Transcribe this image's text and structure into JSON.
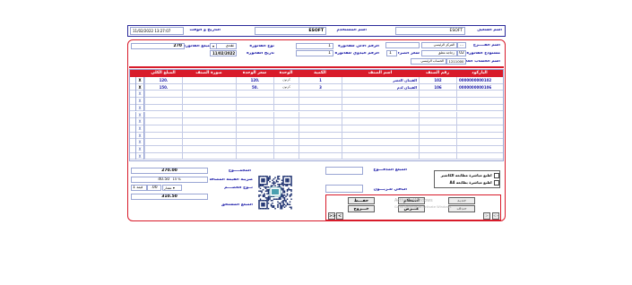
{
  "header": {
    "user_label": "اسم المستخدم",
    "user_value": "ESOFT",
    "company_label": "اسم الشغيل",
    "company_value": "ESOFT",
    "datetime_label": "التاريخ و الوقت",
    "datetime_value": "11/02/2022 13:27:07"
  },
  "form": {
    "branch_label": "اسم الفــــرع",
    "branch_code": "...",
    "branch_name": "المركز الرئيسي",
    "store_label": "مستودع الفاتورة",
    "store_code": "02",
    "store_name": "زجاجة مغلق",
    "rate_label": "سعر الصرف",
    "rate_value": "1",
    "account_label": "اسم الحساب العام",
    "account_code": "1211000",
    "account_name": "الحساب الرئيسي",
    "invoice_no_label": "الرقم الآلي للفاتورة",
    "invoice_no_value": "1",
    "manual_no_label": "الرقم اليدوي للفاتورة",
    "manual_no_value": "1",
    "invoice_type_label": "نوع الفاتورة",
    "invoice_type_value": "نقدي",
    "invoice_date_label": "تاريخ الفاتورة",
    "invoice_date_value": "11/02/2022",
    "invoice_amount_label": "مبلغ الفاتورة",
    "invoice_amount_value": "270"
  },
  "grid": {
    "columns": [
      "الباركود",
      "رقم الصنف",
      "اسم الصنف",
      "الكمية",
      "الوحدة",
      "سعر الوحدة",
      "صورة الصنف",
      "المبلغ الكلي"
    ],
    "rows": [
      {
        "barcode": "0000000000102",
        "item_no": "102",
        "name": "الفيتان العصر",
        "qty": "1",
        "unit": "كرتون",
        "price": "120.",
        "total": "120."
      },
      {
        "barcode": "0000000000106",
        "item_no": "106",
        "name": "الفيتان لدم",
        "qty": "3",
        "unit": "كرتون",
        "price": "50.",
        "total": "150."
      }
    ],
    "row_markers": [
      "X",
      "X",
      "X",
      "X",
      "X",
      "X",
      "X",
      "X",
      "X",
      "X",
      "X",
      "X"
    ]
  },
  "totals": {
    "total_label": "المجمــــوع",
    "total_value": "270.00",
    "vat_label": "ضريبة القيمة المضافة",
    "vat_value": "40.50",
    "vat_rate": "15 %",
    "discount_label": "نــوع الخصـــم",
    "discount_type": "مقدار",
    "discount_value": ".00",
    "discount_after_label": "قيمة",
    "discount_after_value": "1",
    "net_label": "المبلغ المستحق",
    "net_value": "310.50",
    "paid_label": "المبلغ المدفـــوع",
    "remaining_label": "الباقي للـزبـــون"
  },
  "options": {
    "print_direct": "اطبع مباشرة مطابعة الكاشير",
    "print_a4": "اطبع مباشرة بطابعة A4"
  },
  "buttons": {
    "save": "حفـــظ",
    "exit": "خـــروج",
    "query": "استعلام",
    "view": "عـــرض",
    "new": "جديد",
    "delete": "حذف",
    "first": "<<",
    "prev": "<",
    "next": ">",
    "last": ">>"
  },
  "watermark": {
    "line1": "Activate Windows",
    "line2": "Go to Settings to activate Windows."
  },
  "colors": {
    "accent_red": "#d81b2a",
    "frame_blue": "#2a2a9a",
    "label_blue": "#1a1aa8"
  }
}
